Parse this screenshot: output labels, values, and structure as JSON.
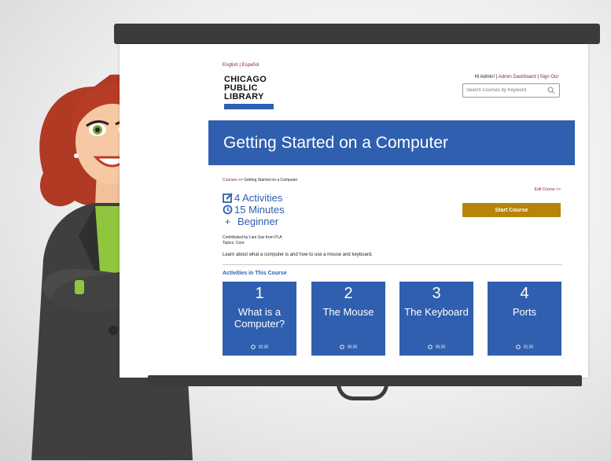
{
  "page": {
    "lang_links": "English | Español",
    "logo": [
      "CHICAGO",
      "PUBLIC",
      "LIBRARY"
    ],
    "user_greeting": "Hi Admin! |",
    "admin_link": "Admin Dashboard",
    "user_sep": "|",
    "sign_out": "Sign Out",
    "search_placeholder": "Search Courses by Keyword",
    "title": "Getting Started on a Computer",
    "breadcrumb_link": "Courses",
    "breadcrumb_rest": ">> Getting Started on a Computer",
    "edit_course": "Edit Course >>",
    "activities_count": "4 Activities",
    "duration": "15 Minutes",
    "level_symbol": "+",
    "level": "Beginner",
    "start_button": "Start Course",
    "contributed_by": "Contributed by Lian Sax from PLA",
    "topics": "Topics: Core",
    "description": "Learn about what a computer is and how to use a mouse and keyboard.",
    "activities_heading": "Activities in This Course",
    "activities": [
      {
        "number": "1",
        "title": "What is a Computer?",
        "time": "02:30"
      },
      {
        "number": "2",
        "title": "The Mouse",
        "time": "05:30"
      },
      {
        "number": "3",
        "title": "The Keyboard",
        "time": "05:30"
      },
      {
        "number": "4",
        "title": "Ports",
        "time": "01:30"
      }
    ]
  },
  "colors": {
    "brand_blue": "#2f5fae",
    "link_purple": "#8a1c5c",
    "button_gold": "#b58408"
  },
  "icons": [
    "edit-icon",
    "clock-icon",
    "search-icon",
    "timer-icon"
  ]
}
